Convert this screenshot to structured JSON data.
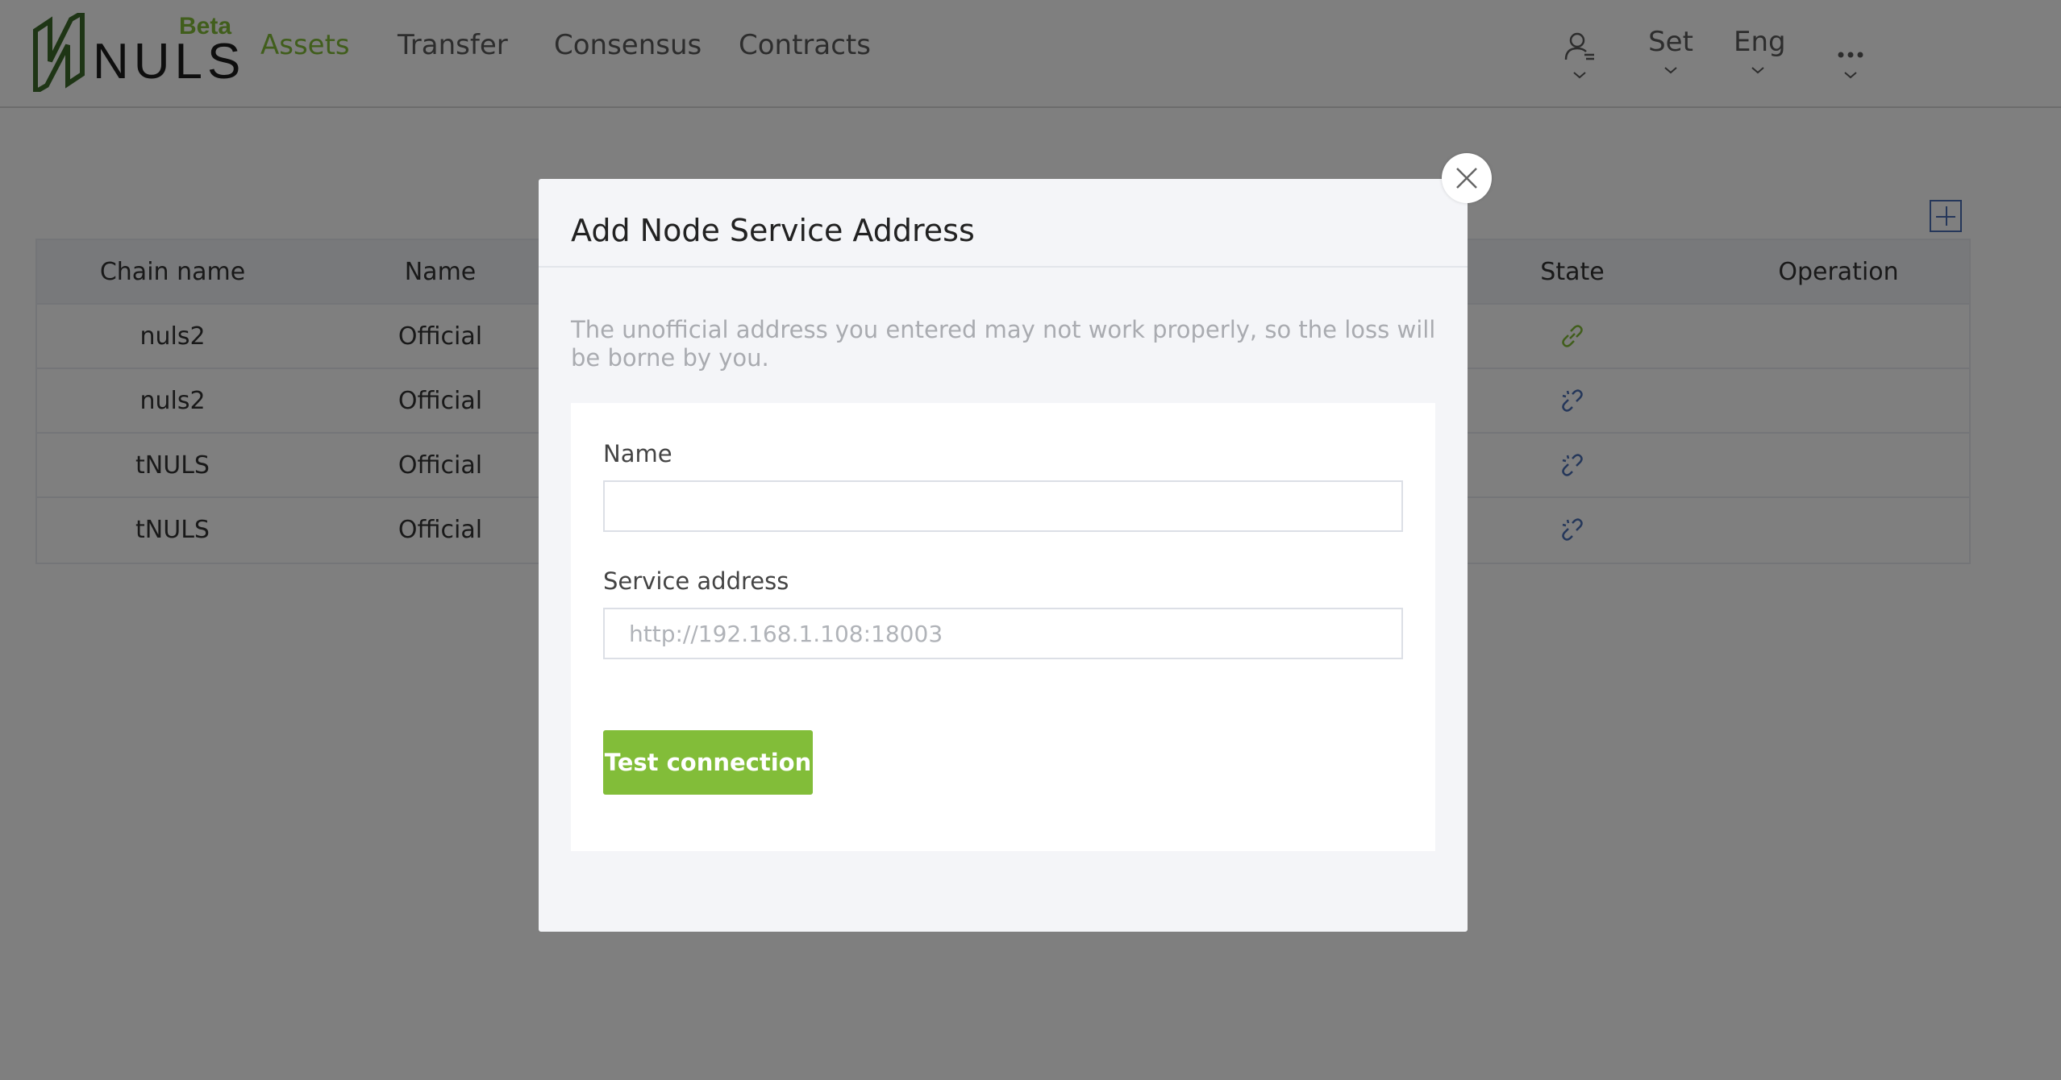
{
  "header": {
    "logo_text": "NULS",
    "logo_badge": "Beta",
    "nav": [
      {
        "label": "Assets",
        "active": true
      },
      {
        "label": "Transfer",
        "active": false
      },
      {
        "label": "Consensus",
        "active": false
      },
      {
        "label": "Contracts",
        "active": false
      }
    ],
    "controls": {
      "account_icon": "user-switch-icon",
      "settings_label": "Set",
      "language_label": "Eng",
      "more_icon": "more-dots-icon"
    },
    "colors": {
      "brand": "#82bd39",
      "link": "#4a6fb5"
    }
  },
  "table": {
    "add_icon": "plus-square-icon",
    "columns": [
      "Chain name",
      "Name",
      "State",
      "Operation"
    ],
    "rows": [
      {
        "chain_name": "nuls2",
        "name": "Official",
        "state": "connected"
      },
      {
        "chain_name": "nuls2",
        "name": "Official",
        "state": "disconnected"
      },
      {
        "chain_name": "tNULS",
        "name": "Official",
        "state": "disconnected"
      },
      {
        "chain_name": "tNULS",
        "name": "Official",
        "state": "disconnected"
      }
    ]
  },
  "modal": {
    "title": "Add Node Service Address",
    "warning": "The unofficial address you entered may not work properly, so the loss will be borne by you.",
    "name_label": "Name",
    "name_value": "",
    "name_placeholder": "",
    "address_label": "Service address",
    "address_value": "",
    "address_placeholder": "http://192.168.1.108:18003",
    "test_button": "Test connection",
    "close_icon": "close-icon"
  }
}
